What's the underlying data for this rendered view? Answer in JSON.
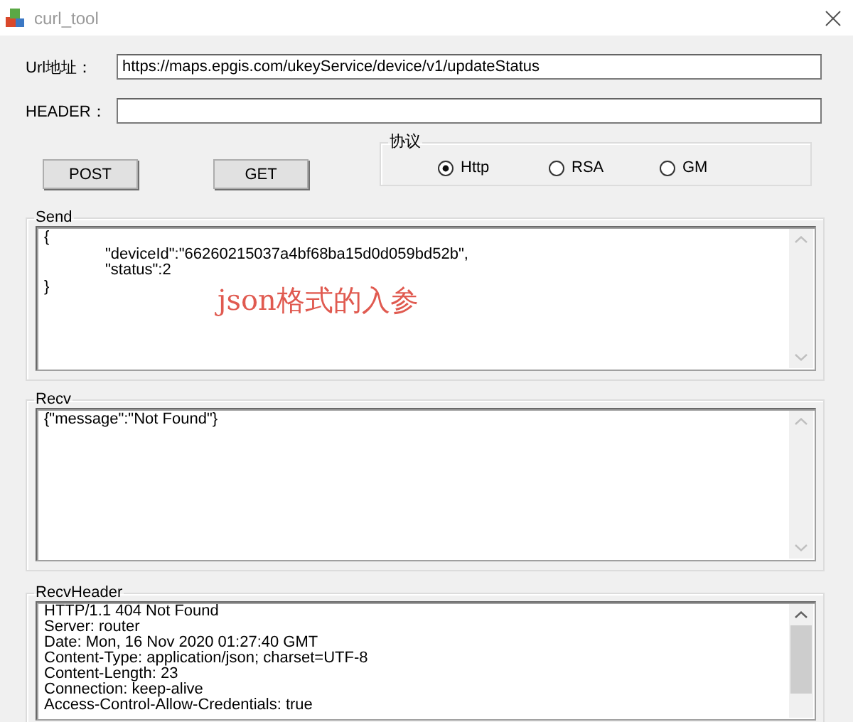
{
  "window": {
    "title": "curl_tool"
  },
  "url": {
    "label": "Url地址：",
    "value": "https://maps.epgis.com/ukeyService/device/v1/updateStatus"
  },
  "header": {
    "label": "HEADER："
  },
  "buttons": [
    "POST",
    "GET"
  ],
  "protocol": {
    "title": "协议",
    "options": [
      {
        "label": "Http",
        "selected": true
      },
      {
        "label": "RSA",
        "selected": false
      },
      {
        "label": "GM",
        "selected": false
      }
    ]
  },
  "send": {
    "title": "Send",
    "lines": [
      "{",
      "\t\"deviceId\":\"66260215037a4bf68ba15d0d059bd52b\",",
      "\t\"status\":2",
      "}"
    ],
    "annotation": "json格式的入参"
  },
  "recv": {
    "title": "Recv",
    "lines": [
      "{\"message\":\"Not Found\"}"
    ]
  },
  "recv_header": {
    "title": "RecvHeader",
    "lines": [
      "HTTP/1.1 404 Not Found",
      "Server: router",
      "Date: Mon, 16 Nov 2020 01:27:40 GMT",
      "Content-Type: application/json; charset=UTF-8",
      "Content-Length: 23",
      "Connection: keep-alive",
      "Access-Control-Allow-Credentials: true"
    ]
  }
}
